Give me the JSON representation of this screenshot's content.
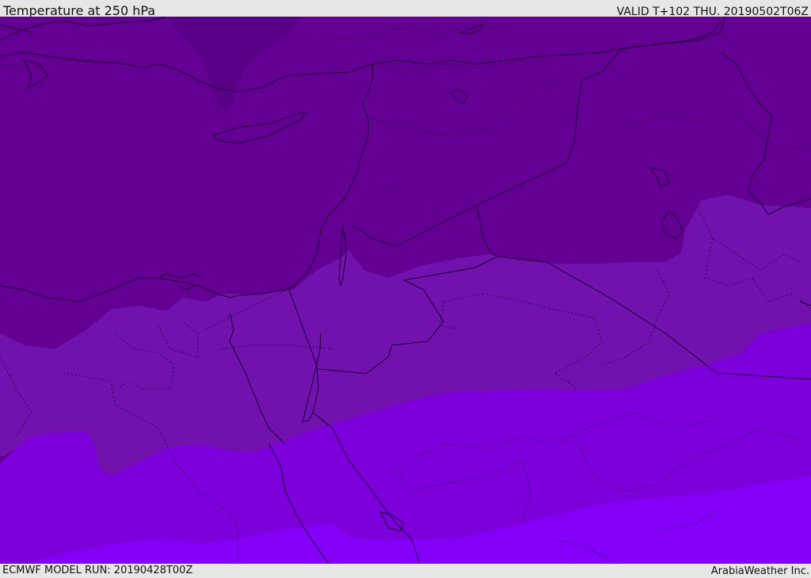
{
  "header": {
    "title": "Temperature at 250 hPa",
    "valid_time": "VALID T+102 THU. 20190502T06Z"
  },
  "footer": {
    "model_run": "ECMWF MODEL RUN: 20190428T00Z",
    "credit": "ArabiaWeather Inc."
  },
  "map": {
    "field": "temperature",
    "level_hpa": 250,
    "colors": {
      "band_darkest": "#5a0088",
      "band_dark": "#650095",
      "band_mid": "#7212ae",
      "band_light": "#7d00dc",
      "band_lightest": "#8400f8",
      "coastline": "#1a0030",
      "border": "#1a0030"
    }
  }
}
